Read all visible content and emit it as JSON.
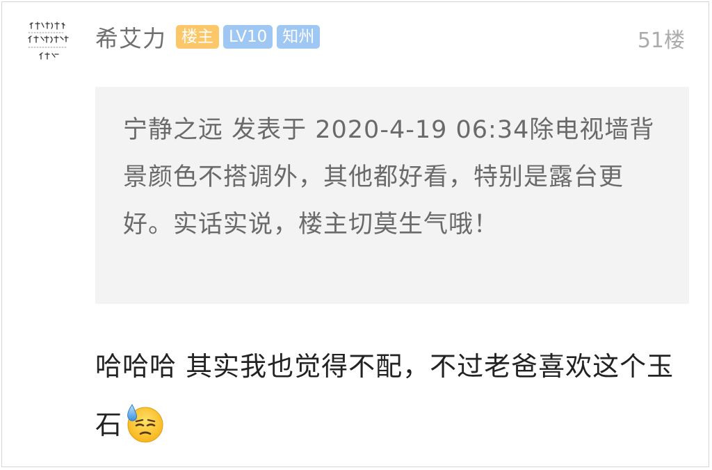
{
  "post": {
    "username": "希艾力",
    "badges": {
      "owner": "楼主",
      "level": "LV10",
      "location": "知州"
    },
    "floor": "51楼",
    "avatar_icon": "handwritten-text-avatar-icon",
    "quote": {
      "text": "宁静之远 发表于 2020-4-19 06:34除电视墙背景颜色不搭调外，其他都好看，特别是露台更好。实话实说，楼主切莫生气哦！"
    },
    "reply": {
      "text": "哈哈哈 其实我也觉得不配，不过老爸喜欢这个玉石",
      "emoji": "sweat-face-emoji"
    }
  },
  "colors": {
    "owner_badge": "#fcc768",
    "level_badge": "#9ec7f4",
    "location_badge": "#9ec7f4",
    "quote_background": "#f3f3f3"
  }
}
